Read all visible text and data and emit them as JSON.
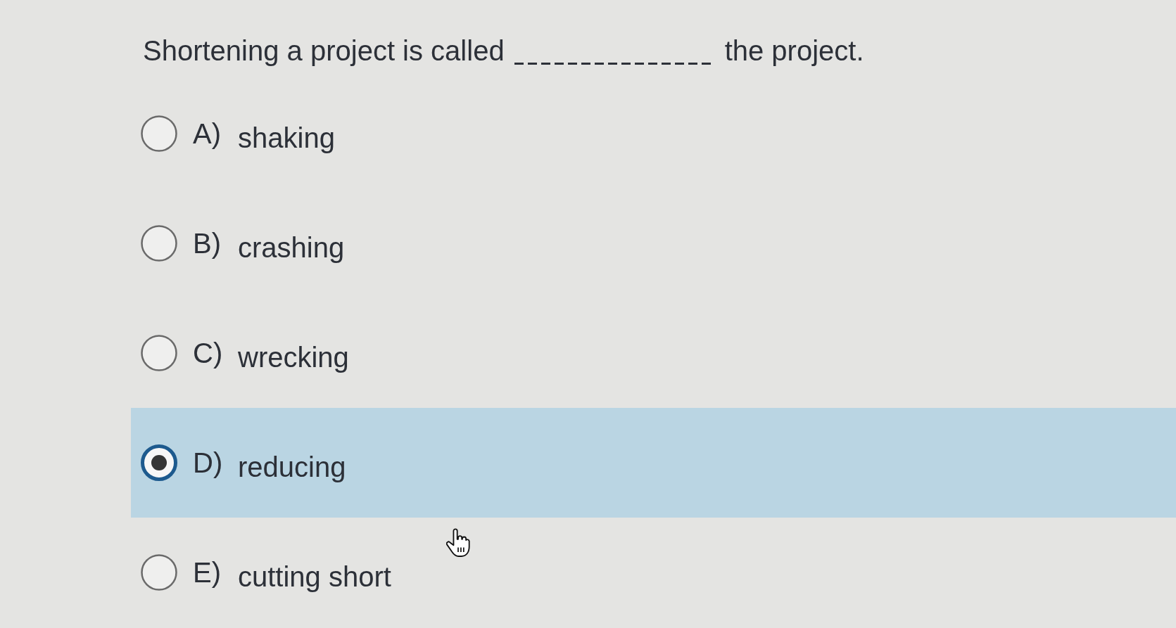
{
  "question": {
    "text_before": "Shortening a project is called",
    "text_after": "the project."
  },
  "options": [
    {
      "letter": "A)",
      "text": "shaking",
      "selected": false
    },
    {
      "letter": "B)",
      "text": "crashing",
      "selected": false
    },
    {
      "letter": "C)",
      "text": "wrecking",
      "selected": false
    },
    {
      "letter": "D)",
      "text": "reducing",
      "selected": true
    },
    {
      "letter": "E)",
      "text": "cutting short",
      "selected": false
    }
  ]
}
